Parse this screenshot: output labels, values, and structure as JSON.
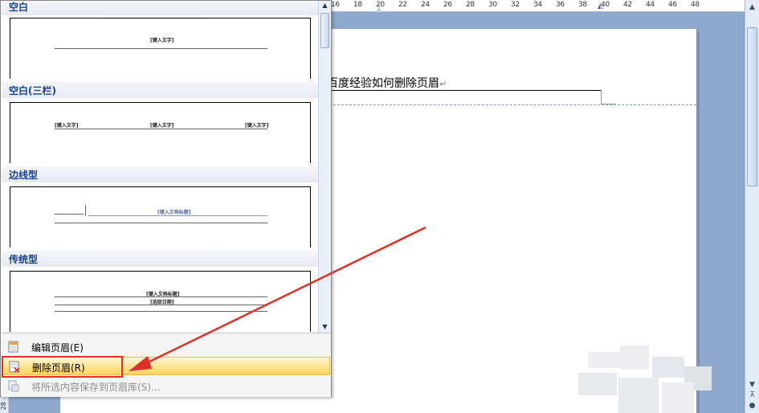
{
  "ruler": {
    "ticks": [
      "16",
      "18",
      "20",
      "22",
      "24",
      "26",
      "28",
      "30",
      "32",
      "34",
      "36",
      "38",
      "40",
      "42",
      "44",
      "46",
      "48"
    ]
  },
  "left_ruler": {
    "label": "28"
  },
  "document": {
    "header_text": "百度经验如何删除页眉",
    "pilcrow": "↵"
  },
  "gallery": {
    "sections": [
      {
        "title": "空白",
        "placeholders": [
          "[键入文字]"
        ]
      },
      {
        "title": "空白(三栏)",
        "placeholders": [
          "[键入文字]",
          "[键入文字]",
          "[键入文字]"
        ]
      },
      {
        "title": "边线型",
        "placeholders": [
          "[键入文档标题]"
        ]
      },
      {
        "title": "传统型",
        "placeholders": [
          "[键入文档标题]",
          "[选取日期]"
        ]
      }
    ]
  },
  "menu": {
    "edit_header": "编辑页眉(E)",
    "remove_header": "删除页眉(R)",
    "save_selection": "将所选内容保存到页眉库(S)..."
  },
  "colors": {
    "accent_red": "#e0302a",
    "section_title": "#15428b",
    "hover_yellow": "#ffe28a"
  }
}
